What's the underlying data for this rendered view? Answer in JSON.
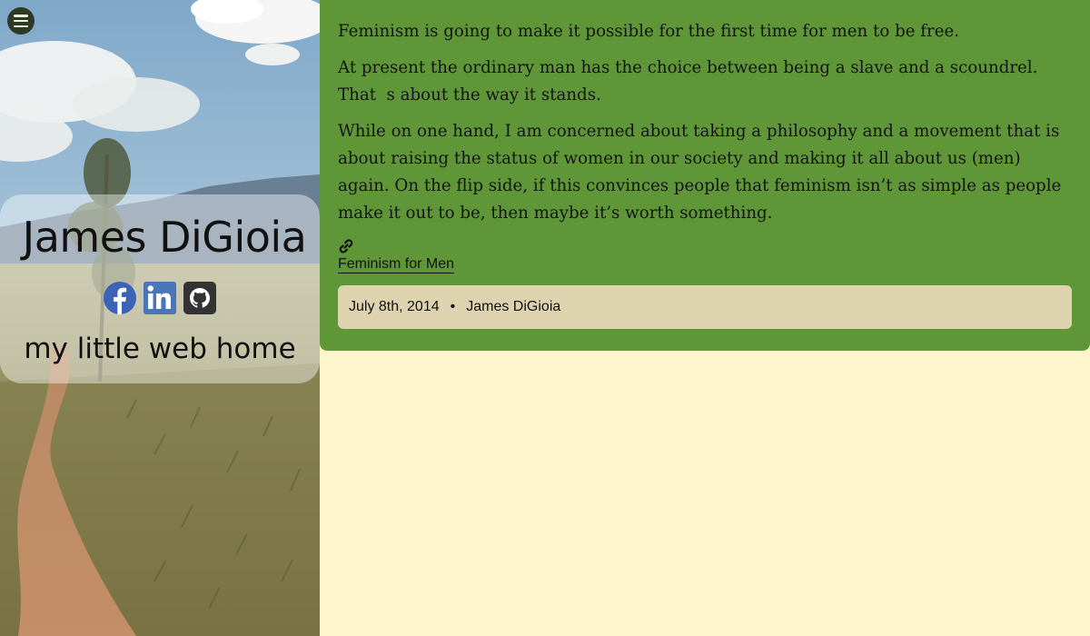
{
  "sidebar": {
    "menu_icon": "hamburger-menu-icon",
    "name": "James DiGioia",
    "tagline": "my little web home",
    "social": [
      {
        "icon": "facebook-icon",
        "color": "#3b63b8"
      },
      {
        "icon": "linkedin-icon",
        "color": "#4a76b8"
      },
      {
        "icon": "github-icon",
        "color": "#333333"
      }
    ]
  },
  "post": {
    "paragraphs": [
      "Feminism is going to make it possible for the first time for men to be free.",
      "At present the ordinary man has the choice between being a slave and a scoundrel. That  s about the way it stands.",
      "While on one hand, I am concerned about taking a philosophy and a movement that is about raising the status of women in our society and making it all about us (men) again. On the flip side, if this convinces people that feminism isn’t as simple as people make it out to be, then maybe it’s worth something."
    ],
    "link_icon": "link-icon",
    "source_link": "Feminism for Men",
    "date": "July 8th, 2014",
    "separator": "•",
    "author": "James DiGioia"
  },
  "colors": {
    "page_background": "#fff5cc",
    "post_background": "#5e9638",
    "meta_background": "#ddd3ae"
  }
}
